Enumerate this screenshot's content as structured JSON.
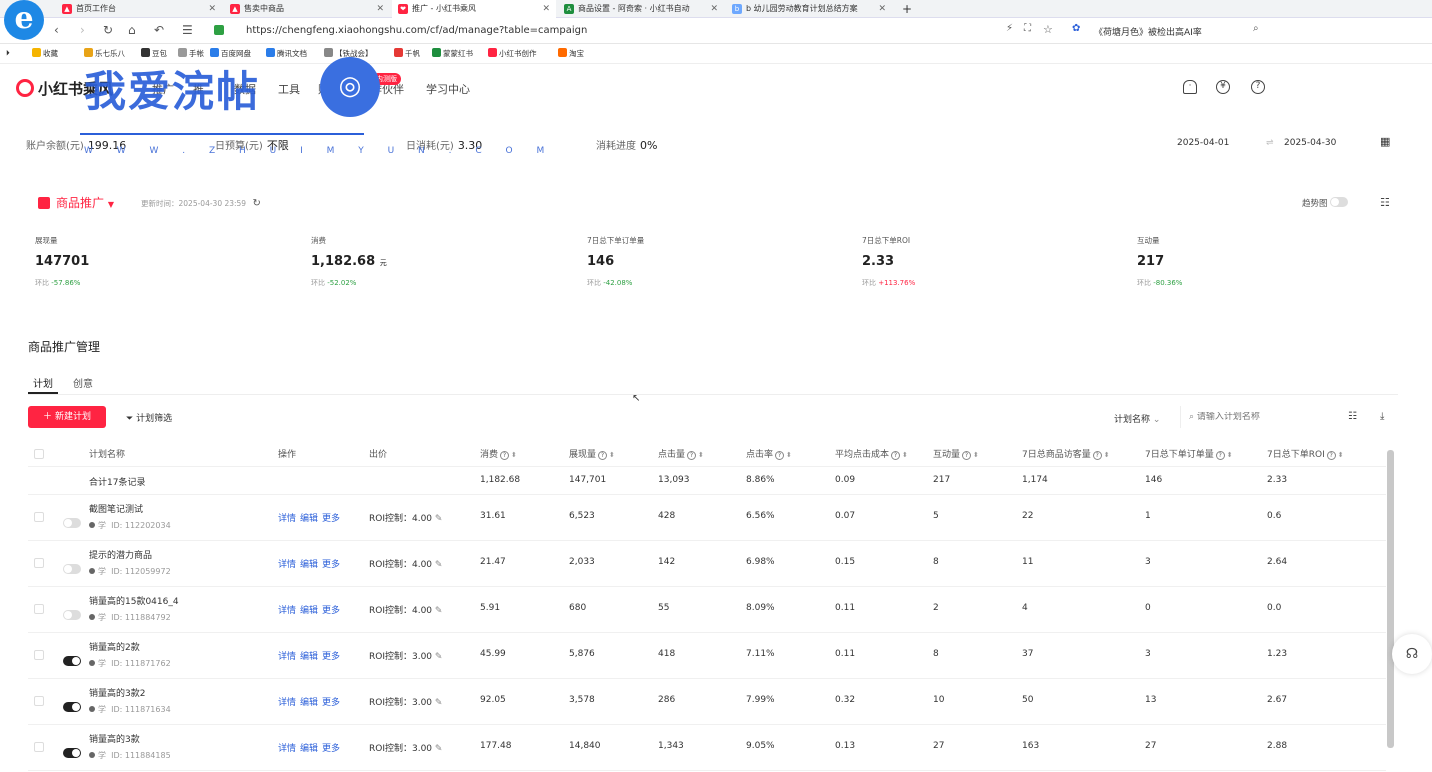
{
  "browser": {
    "tabs": [
      {
        "title": "首页工作台",
        "active": false
      },
      {
        "title": "售卖中商品",
        "active": false
      },
      {
        "title": "推广 - 小红书乘风",
        "active": true
      },
      {
        "title": "商品设置 - 阿奇索 · 小红书自动",
        "active": false
      },
      {
        "title": "b 幼儿园劳动教育计划总结方案",
        "active": false
      }
    ],
    "new_tab": "+",
    "url": "https://chengfeng.xiaohongshu.com/cf/ad/manage?table=campaign",
    "right_search": "《荷塘月色》被检出高AI率",
    "bookmarks": [
      "收藏",
      "乐七乐八",
      "豆包",
      "手帐",
      "百度网盘",
      "腾讯文档",
      "【铁战会】",
      "千帆",
      "蒙蒙红书",
      "小红书创作",
      "淘宝"
    ]
  },
  "app": {
    "brand": "小红书乘风",
    "nav": [
      "推广",
      "推",
      "数据",
      "工具",
      "财务",
      "合作伙伴",
      "学习中心"
    ],
    "nav_badge": "内测版",
    "watermark": {
      "text": "我爱浣帖",
      "url": "W W W . Z H U I M Y U N . C O M"
    }
  },
  "account": {
    "balance_label": "账户余额(元)",
    "balance": "199.16",
    "budget_label": "日预算(元)",
    "budget": "不限",
    "spent_label": "日消耗(元)",
    "spent": "3.30",
    "progress_label": "消耗进度",
    "progress": "0%",
    "date_start": "2025-04-01",
    "date_end": "2025-04-30"
  },
  "promo": {
    "title": "商品推广",
    "updated": "更新时间：2025-04-30 23:59",
    "trend_label": "趋势图",
    "metrics": [
      {
        "label": "展现量",
        "value": "147701",
        "unit": "",
        "cmp_label": "环比",
        "cmp": "-57.86%",
        "dir": "down"
      },
      {
        "label": "消费",
        "value": "1,182.68",
        "unit": "元",
        "cmp_label": "环比",
        "cmp": "-52.02%",
        "dir": "down"
      },
      {
        "label": "7日总下单订单量",
        "value": "146",
        "unit": "",
        "cmp_label": "环比",
        "cmp": "-42.08%",
        "dir": "down"
      },
      {
        "label": "7日总下单ROI",
        "value": "2.33",
        "unit": "",
        "cmp_label": "环比",
        "cmp": "+113.76%",
        "dir": "up"
      },
      {
        "label": "互动量",
        "value": "217",
        "unit": "",
        "cmp_label": "环比",
        "cmp": "-80.36%",
        "dir": "down"
      }
    ]
  },
  "management": {
    "title": "商品推广管理",
    "tabs": [
      "计划",
      "创意"
    ],
    "new_button": "新建计划",
    "filter_button": "计划筛选",
    "plan_select": "计划名称",
    "search_placeholder": "请输入计划名称"
  },
  "table": {
    "headers": [
      "计划名称",
      "操作",
      "出价",
      "消费",
      "展现量",
      "点击量",
      "点击率",
      "平均点击成本",
      "互动量",
      "7日总商品访客量",
      "7日总下单订单量",
      "7日总下单ROI"
    ],
    "summary": {
      "label": "合计17条记录",
      "spend": "1,182.68",
      "impressions": "147,701",
      "clicks": "13,093",
      "ctr": "8.86%",
      "cpc": "0.09",
      "interactions": "217",
      "visitors": "1,174",
      "orders": "146",
      "roi": "2.33"
    },
    "ops": [
      "详情",
      "编辑",
      "更多"
    ],
    "id_prefix": "学",
    "rows": [
      {
        "name": "截图笔记测试",
        "id": "ID: 112202034",
        "on": false,
        "bid": "ROI控制：4.00",
        "spend": "31.61",
        "impressions": "6,523",
        "clicks": "428",
        "ctr": "6.56%",
        "cpc": "0.07",
        "interactions": "5",
        "visitors": "22",
        "orders": "1",
        "roi": "0.6"
      },
      {
        "name": "提示的潜力商品",
        "id": "ID: 112059972",
        "on": false,
        "bid": "ROI控制：4.00",
        "spend": "21.47",
        "impressions": "2,033",
        "clicks": "142",
        "ctr": "6.98%",
        "cpc": "0.15",
        "interactions": "8",
        "visitors": "11",
        "orders": "3",
        "roi": "2.64"
      },
      {
        "name": "销量高的15款0416_4",
        "id": "ID: 111884792",
        "on": false,
        "bid": "ROI控制：4.00",
        "spend": "5.91",
        "impressions": "680",
        "clicks": "55",
        "ctr": "8.09%",
        "cpc": "0.11",
        "interactions": "2",
        "visitors": "4",
        "orders": "0",
        "roi": "0.0"
      },
      {
        "name": "销量高的2款",
        "id": "ID: 111871762",
        "on": true,
        "bid": "ROI控制：3.00",
        "spend": "45.99",
        "impressions": "5,876",
        "clicks": "418",
        "ctr": "7.11%",
        "cpc": "0.11",
        "interactions": "8",
        "visitors": "37",
        "orders": "3",
        "roi": "1.23"
      },
      {
        "name": "销量高的3款2",
        "id": "ID: 111871634",
        "on": true,
        "bid": "ROI控制：3.00",
        "spend": "92.05",
        "impressions": "3,578",
        "clicks": "286",
        "ctr": "7.99%",
        "cpc": "0.32",
        "interactions": "10",
        "visitors": "50",
        "orders": "13",
        "roi": "2.67"
      },
      {
        "name": "销量高的3款",
        "id": "ID: 111884185",
        "on": true,
        "bid": "ROI控制：3.00",
        "spend": "177.48",
        "impressions": "14,840",
        "clicks": "1,343",
        "ctr": "9.05%",
        "cpc": "0.13",
        "interactions": "27",
        "visitors": "163",
        "orders": "27",
        "roi": "2.88"
      }
    ]
  },
  "colors": {
    "brand_red": "#ff2442",
    "link_blue": "#2b5fd9",
    "watermark_blue": "#2b5fd9"
  }
}
